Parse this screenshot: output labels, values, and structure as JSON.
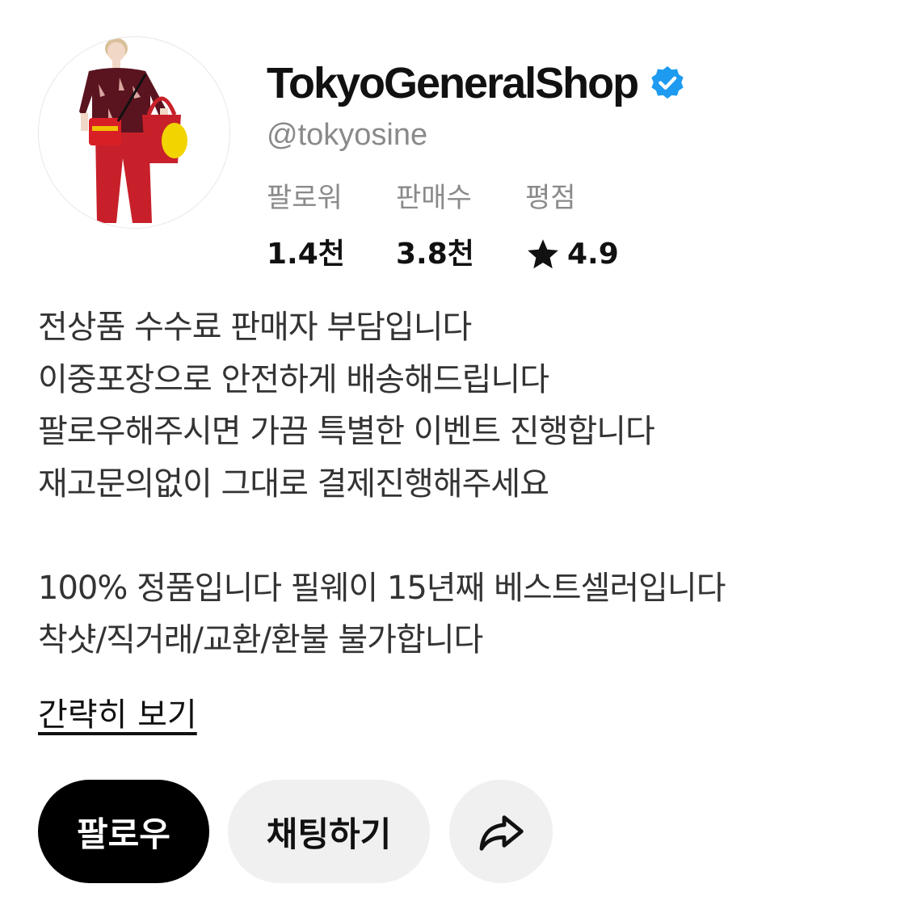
{
  "profile": {
    "shop_name": "TokyoGeneralShop",
    "verified": true,
    "handle": "@tokyosine",
    "avatar_icon": "avatar-fashion-model-photo"
  },
  "stats": [
    {
      "label": "팔로워",
      "value": "1.4천"
    },
    {
      "label": "판매수",
      "value": "3.8천"
    },
    {
      "label": "평점",
      "value": "4.9",
      "icon": "star-icon"
    }
  ],
  "bio": {
    "lines": [
      "전상품 수수료 판매자 부담입니다",
      "이중포장으로 안전하게 배송해드립니다",
      "팔로우해주시면 가끔 특별한 이벤트 진행합니다",
      "재고문의없이 그대로 결제진행해주세요",
      "",
      "100% 정품입니다 필웨이 15년째 베스트셀러입니다",
      "착샷/직거래/교환/환불 불가합니다"
    ],
    "collapse_label": "간략히 보기"
  },
  "actions": {
    "follow_label": "팔로우",
    "chat_label": "채팅하기",
    "share_icon": "share-icon"
  },
  "colors": {
    "verified_badge": "#1d9bf0",
    "primary_button": "#000000",
    "secondary_button": "#f0f0f0",
    "muted_text": "#8a8a8a"
  }
}
